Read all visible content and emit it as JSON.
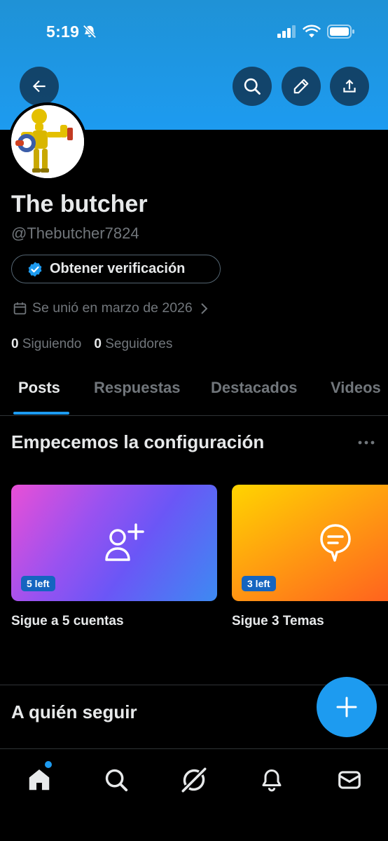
{
  "status_bar": {
    "time": "5:19"
  },
  "profile": {
    "name": "The butcher",
    "handle": "@Thebutcher7824",
    "verify_button": "Obtener verificación",
    "joined": "Se unió en marzo de 2026",
    "following_count": "0",
    "following_label": "Siguiendo",
    "followers_count": "0",
    "followers_label": "Seguidores"
  },
  "tabs": [
    {
      "label": "Posts",
      "active": true
    },
    {
      "label": "Respuestas",
      "active": false
    },
    {
      "label": "Destacados",
      "active": false
    },
    {
      "label": "Videos",
      "active": false
    }
  ],
  "setup": {
    "title": "Empecemos la configuración",
    "cards": [
      {
        "badge": "5 left",
        "caption": "Sigue a 5 cuentas",
        "icon": "add-user-icon"
      },
      {
        "badge": "3 left",
        "caption": "Sigue 3 Temas",
        "icon": "topic-bubble-icon"
      }
    ]
  },
  "who_to_follow": {
    "title": "A quién seguir"
  },
  "bottom_nav": [
    "home-icon",
    "search-icon",
    "grok-icon",
    "bell-icon",
    "mail-icon"
  ],
  "colors": {
    "accent": "#1d9bf0",
    "background": "#000000",
    "text_primary": "#e7e9ea",
    "text_secondary": "#71767b",
    "banner": "#1d9bf0"
  }
}
